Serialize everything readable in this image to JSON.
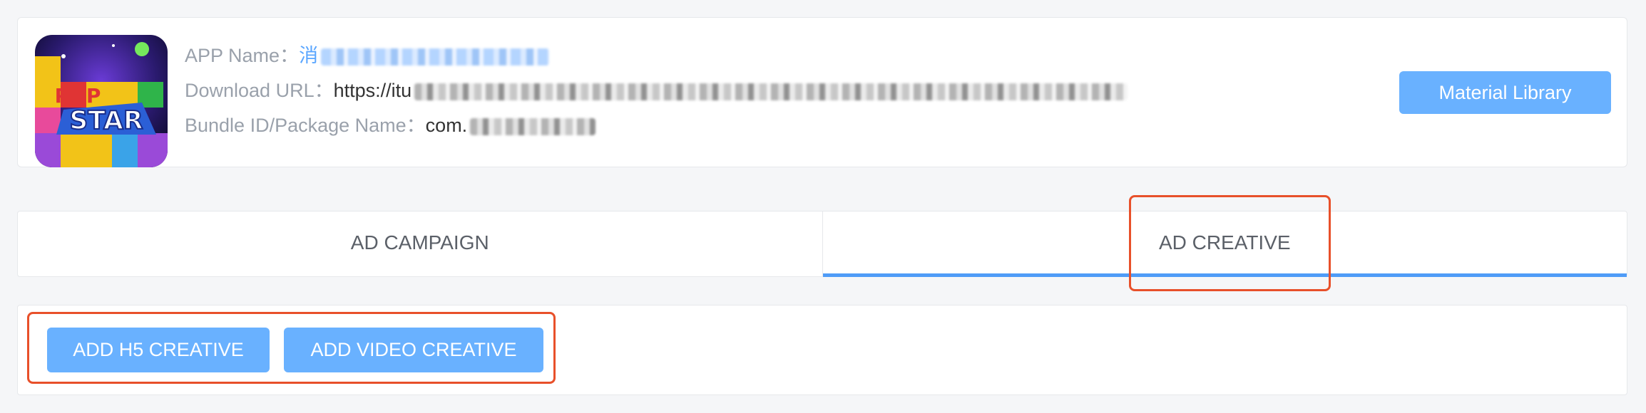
{
  "app_info": {
    "name_label": "APP Name：",
    "name_value_visible": "消",
    "download_url_label": "Download URL：",
    "download_url_visible": "https://itu",
    "bundle_label": "Bundle ID/Package Name：",
    "bundle_visible": "com.",
    "icon_text": "STAR",
    "icon_name": "pop-star-app-icon"
  },
  "toolbar": {
    "material_library_label": "Material Library"
  },
  "tabs": [
    {
      "label": "AD CAMPAIGN",
      "active": false
    },
    {
      "label": "AD CREATIVE",
      "active": true
    }
  ],
  "actions": {
    "add_h5_label": "ADD H5 CREATIVE",
    "add_video_label": "ADD VIDEO CREATIVE"
  },
  "colors": {
    "accent": "#69b1ff",
    "tab_indicator": "#4f9cf7",
    "highlight": "#e8502a"
  }
}
